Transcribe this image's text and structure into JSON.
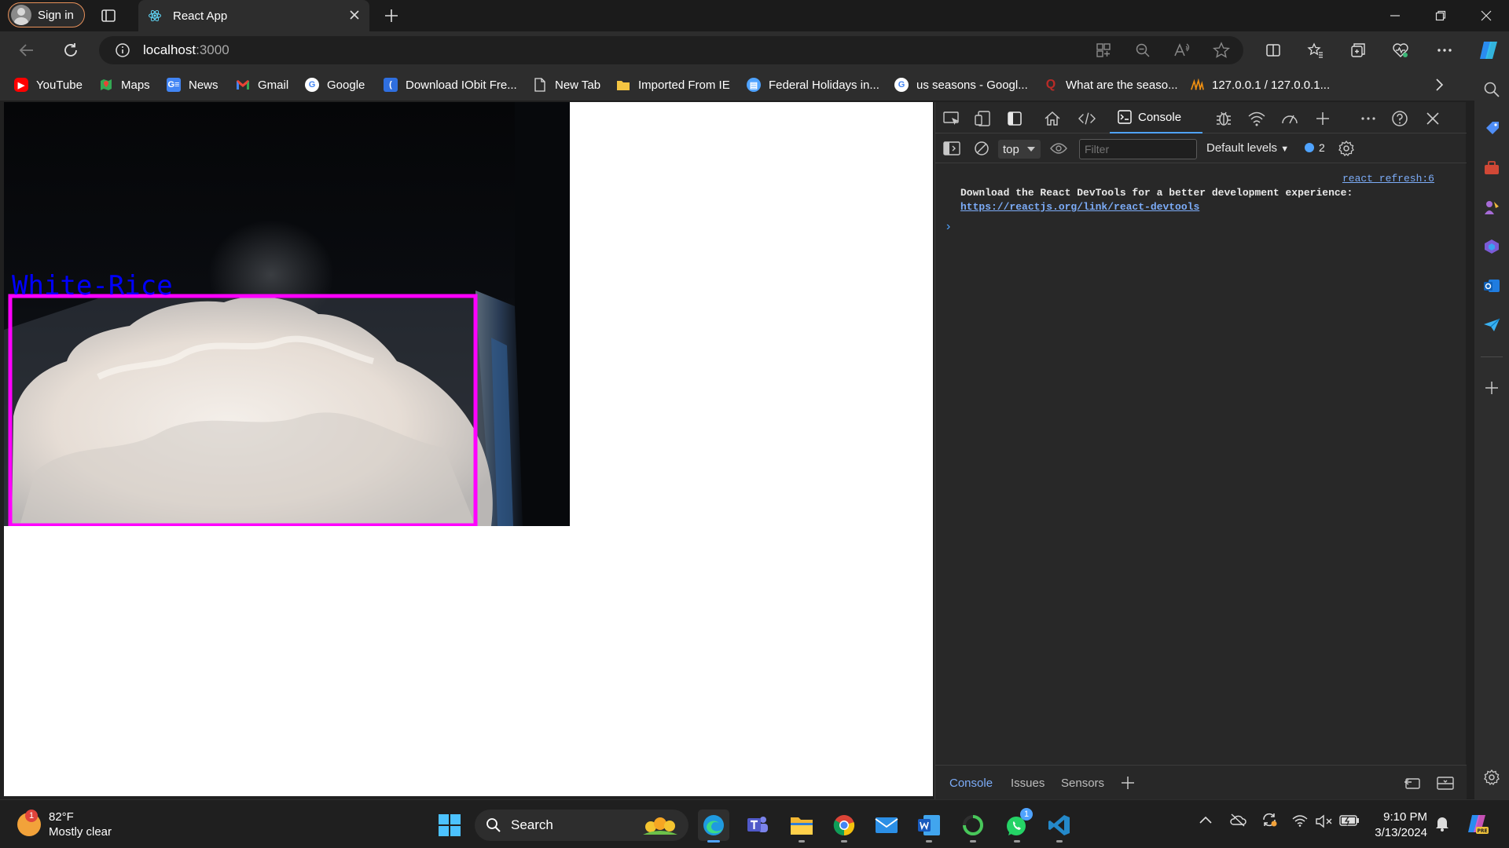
{
  "browser": {
    "signin_label": "Sign in",
    "tab_title": "React App",
    "url_host": "localhost",
    "url_port": ":3000"
  },
  "bookmarks": [
    {
      "label": "YouTube",
      "icon": "youtube-icon",
      "color": "#ff0000"
    },
    {
      "label": "Maps",
      "icon": "maps-icon",
      "color": "#34a853"
    },
    {
      "label": "News",
      "icon": "news-icon",
      "color": "#4285f4"
    },
    {
      "label": "Gmail",
      "icon": "gmail-icon",
      "color": "#ea4335"
    },
    {
      "label": "Google",
      "icon": "google-icon",
      "color": "#ffffff"
    },
    {
      "label": "Download IObit Fre...",
      "icon": "iobit-icon",
      "color": "#2f6fe0"
    },
    {
      "label": "New Tab",
      "icon": "page-icon",
      "color": "#d0d0d0"
    },
    {
      "label": "Imported From IE",
      "icon": "folder-icon",
      "color": "#f4c542"
    },
    {
      "label": "Federal Holidays in...",
      "icon": "calendar-icon",
      "color": "#4fa3ff"
    },
    {
      "label": "us seasons - Googl...",
      "icon": "google-icon",
      "color": "#ffffff"
    },
    {
      "label": "What are the seaso...",
      "icon": "quora-icon",
      "color": "#b92b27"
    },
    {
      "label": "127.0.0.1 / 127.0.0.1...",
      "icon": "phpmyadmin-icon",
      "color": "#f29111"
    }
  ],
  "detection": {
    "label": "White-Rice",
    "label_color": "#0000ff",
    "box_color": "#ff00ff"
  },
  "devtools": {
    "console_tab": "Console",
    "context": "top",
    "filter_placeholder": "Filter",
    "levels": "Default levels",
    "message_count": "2",
    "log_source": "react_refresh:6",
    "log_text": "Download the React DevTools for a better development experience: ",
    "log_link": "https://reactjs.org/link/react-devtools",
    "drawer_tabs": [
      "Console",
      "Issues",
      "Sensors"
    ]
  },
  "taskbar": {
    "weather_temp": "82°F",
    "weather_desc": "Mostly clear",
    "weather_badge": "1",
    "search_label": "Search",
    "whatsapp_badge": "1",
    "time": "9:10 PM",
    "date": "3/13/2024"
  }
}
